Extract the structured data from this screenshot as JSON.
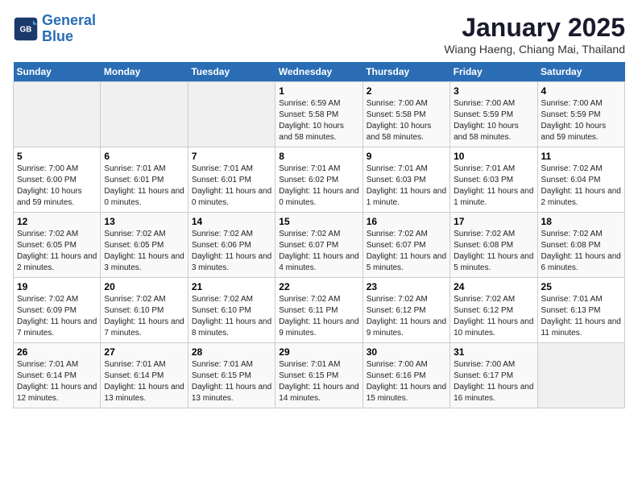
{
  "header": {
    "logo_line1": "General",
    "logo_line2": "Blue",
    "title": "January 2025",
    "subtitle": "Wiang Haeng, Chiang Mai, Thailand"
  },
  "weekdays": [
    "Sunday",
    "Monday",
    "Tuesday",
    "Wednesday",
    "Thursday",
    "Friday",
    "Saturday"
  ],
  "weeks": [
    [
      {
        "num": "",
        "info": ""
      },
      {
        "num": "",
        "info": ""
      },
      {
        "num": "",
        "info": ""
      },
      {
        "num": "1",
        "info": "Sunrise: 6:59 AM\nSunset: 5:58 PM\nDaylight: 10 hours and 58 minutes."
      },
      {
        "num": "2",
        "info": "Sunrise: 7:00 AM\nSunset: 5:58 PM\nDaylight: 10 hours and 58 minutes."
      },
      {
        "num": "3",
        "info": "Sunrise: 7:00 AM\nSunset: 5:59 PM\nDaylight: 10 hours and 58 minutes."
      },
      {
        "num": "4",
        "info": "Sunrise: 7:00 AM\nSunset: 5:59 PM\nDaylight: 10 hours and 59 minutes."
      }
    ],
    [
      {
        "num": "5",
        "info": "Sunrise: 7:00 AM\nSunset: 6:00 PM\nDaylight: 10 hours and 59 minutes."
      },
      {
        "num": "6",
        "info": "Sunrise: 7:01 AM\nSunset: 6:01 PM\nDaylight: 11 hours and 0 minutes."
      },
      {
        "num": "7",
        "info": "Sunrise: 7:01 AM\nSunset: 6:01 PM\nDaylight: 11 hours and 0 minutes."
      },
      {
        "num": "8",
        "info": "Sunrise: 7:01 AM\nSunset: 6:02 PM\nDaylight: 11 hours and 0 minutes."
      },
      {
        "num": "9",
        "info": "Sunrise: 7:01 AM\nSunset: 6:03 PM\nDaylight: 11 hours and 1 minute."
      },
      {
        "num": "10",
        "info": "Sunrise: 7:01 AM\nSunset: 6:03 PM\nDaylight: 11 hours and 1 minute."
      },
      {
        "num": "11",
        "info": "Sunrise: 7:02 AM\nSunset: 6:04 PM\nDaylight: 11 hours and 2 minutes."
      }
    ],
    [
      {
        "num": "12",
        "info": "Sunrise: 7:02 AM\nSunset: 6:05 PM\nDaylight: 11 hours and 2 minutes."
      },
      {
        "num": "13",
        "info": "Sunrise: 7:02 AM\nSunset: 6:05 PM\nDaylight: 11 hours and 3 minutes."
      },
      {
        "num": "14",
        "info": "Sunrise: 7:02 AM\nSunset: 6:06 PM\nDaylight: 11 hours and 3 minutes."
      },
      {
        "num": "15",
        "info": "Sunrise: 7:02 AM\nSunset: 6:07 PM\nDaylight: 11 hours and 4 minutes."
      },
      {
        "num": "16",
        "info": "Sunrise: 7:02 AM\nSunset: 6:07 PM\nDaylight: 11 hours and 5 minutes."
      },
      {
        "num": "17",
        "info": "Sunrise: 7:02 AM\nSunset: 6:08 PM\nDaylight: 11 hours and 5 minutes."
      },
      {
        "num": "18",
        "info": "Sunrise: 7:02 AM\nSunset: 6:08 PM\nDaylight: 11 hours and 6 minutes."
      }
    ],
    [
      {
        "num": "19",
        "info": "Sunrise: 7:02 AM\nSunset: 6:09 PM\nDaylight: 11 hours and 7 minutes."
      },
      {
        "num": "20",
        "info": "Sunrise: 7:02 AM\nSunset: 6:10 PM\nDaylight: 11 hours and 7 minutes."
      },
      {
        "num": "21",
        "info": "Sunrise: 7:02 AM\nSunset: 6:10 PM\nDaylight: 11 hours and 8 minutes."
      },
      {
        "num": "22",
        "info": "Sunrise: 7:02 AM\nSunset: 6:11 PM\nDaylight: 11 hours and 9 minutes."
      },
      {
        "num": "23",
        "info": "Sunrise: 7:02 AM\nSunset: 6:12 PM\nDaylight: 11 hours and 9 minutes."
      },
      {
        "num": "24",
        "info": "Sunrise: 7:02 AM\nSunset: 6:12 PM\nDaylight: 11 hours and 10 minutes."
      },
      {
        "num": "25",
        "info": "Sunrise: 7:01 AM\nSunset: 6:13 PM\nDaylight: 11 hours and 11 minutes."
      }
    ],
    [
      {
        "num": "26",
        "info": "Sunrise: 7:01 AM\nSunset: 6:14 PM\nDaylight: 11 hours and 12 minutes."
      },
      {
        "num": "27",
        "info": "Sunrise: 7:01 AM\nSunset: 6:14 PM\nDaylight: 11 hours and 13 minutes."
      },
      {
        "num": "28",
        "info": "Sunrise: 7:01 AM\nSunset: 6:15 PM\nDaylight: 11 hours and 13 minutes."
      },
      {
        "num": "29",
        "info": "Sunrise: 7:01 AM\nSunset: 6:15 PM\nDaylight: 11 hours and 14 minutes."
      },
      {
        "num": "30",
        "info": "Sunrise: 7:00 AM\nSunset: 6:16 PM\nDaylight: 11 hours and 15 minutes."
      },
      {
        "num": "31",
        "info": "Sunrise: 7:00 AM\nSunset: 6:17 PM\nDaylight: 11 hours and 16 minutes."
      },
      {
        "num": "",
        "info": ""
      }
    ]
  ]
}
